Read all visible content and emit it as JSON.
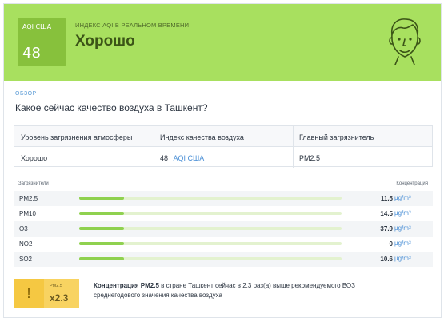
{
  "banner": {
    "aqi_label": "AQI США",
    "aqi_value": "48",
    "realtime_label": "ИНДЕКС AQI В РЕАЛЬНОМ ВРЕМЕНИ",
    "status": "Хорошо",
    "face_icon": "smiling-face-icon",
    "color": "#a8e05f"
  },
  "overview": {
    "label": "ОБЗОР",
    "question": "Какое сейчас качество воздуха в Ташкент?"
  },
  "info_table": {
    "headers": [
      "Уровень загрязнения атмосферы",
      "Индекс качества воздуха",
      "Главный загрязнитель"
    ],
    "pollution_level": "Хорошо",
    "aqi_number": "48",
    "aqi_unit": "AQI США",
    "main_pollutant": "PM2.5"
  },
  "pollutants": {
    "col_pollutant": "Загрязнители",
    "col_concentration": "Концентрация",
    "unit": "μg/m³",
    "rows": [
      {
        "name": "PM2.5",
        "value": "11.5",
        "fill": 0.17
      },
      {
        "name": "PM10",
        "value": "14.5",
        "fill": 0.17
      },
      {
        "name": "O3",
        "value": "37.9",
        "fill": 0.17
      },
      {
        "name": "NO2",
        "value": "0",
        "fill": 0.17
      },
      {
        "name": "SO2",
        "value": "10.6",
        "fill": 0.17
      }
    ]
  },
  "warning": {
    "mark": "!",
    "small_label": "PM2.5",
    "multiplier": "x2.3",
    "text_bold": "Концентрация PM2.5",
    "text_rest": " в стране Ташкент сейчас в 2.3 раз(а) выше рекомендуемого ВОЗ среднегодового значения качества воздуха"
  }
}
